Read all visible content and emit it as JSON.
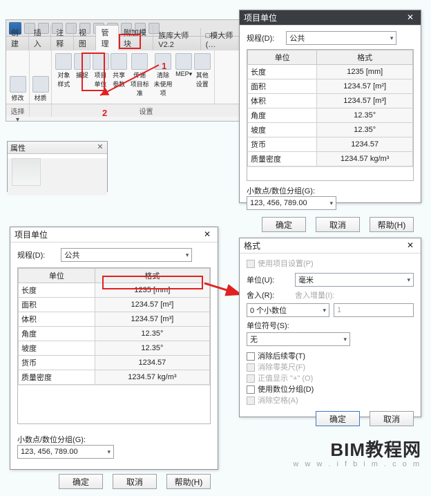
{
  "ribbon": {
    "tabs": [
      "创建",
      "插入",
      "注释",
      "视图",
      "管理",
      "附加模块",
      "族库大师V2.2",
      "□模大师(…"
    ],
    "active_tab": "管理",
    "buttons": {
      "modify": "修改",
      "material": "材质",
      "object_style": "对象\n样式",
      "snap": "捕捉",
      "proj_unit_l1": "项目",
      "proj_unit_l2": "单位",
      "shared_param_l1": "共享",
      "shared_param_l2": "参数",
      "transfer_l1": "传递",
      "transfer_l2": "项目标准",
      "purge_l1": "清除",
      "purge_l2": "未使用项",
      "mep": "MEP▾",
      "addl": "其他\n设置"
    },
    "panels": [
      "选择 ▾",
      "",
      "设置",
      ""
    ],
    "annot": {
      "one": "1",
      "two": "2"
    }
  },
  "properties": {
    "title": "属性",
    "close": "✕"
  },
  "proj_units": {
    "title": "项目单位",
    "discipline_label": "规程(D):",
    "discipline_value": "公共",
    "col_unit": "单位",
    "col_format": "格式",
    "rows": [
      {
        "u": "长度",
        "f": "1235 [mm]"
      },
      {
        "u": "面积",
        "f": "1234.57 [m²]"
      },
      {
        "u": "体积",
        "f": "1234.57 [m³]"
      },
      {
        "u": "角度",
        "f": "12.35°"
      },
      {
        "u": "坡度",
        "f": "12.35°"
      },
      {
        "u": "货币",
        "f": "1234.57"
      },
      {
        "u": "质量密度",
        "f": "1234.57 kg/m³"
      }
    ],
    "grouping_label": "小数点/数位分组(G):",
    "grouping_value1": "123, 456, 789.00",
    "grouping_value2": "123, 456, 789.00",
    "ok": "确定",
    "cancel": "取消",
    "help": "帮助(H)",
    "close": "✕"
  },
  "format": {
    "title": "格式",
    "use_proj": "使用项目设置(P)",
    "unit_label": "单位(U):",
    "unit_value": "毫米",
    "round_label": "舍入(R):",
    "round_value": "0 个小数位",
    "round_inc_label": "舍入增量(I):",
    "round_inc_value": "1",
    "symbol_label": "单位符号(S):",
    "symbol_value": "无",
    "strip_trailing": "消除后续零(T)",
    "strip_feet": "消除零英尺(F)",
    "show_plus": "正值显示 \"+\" (O)",
    "digit_group": "使用数位分组(D)",
    "strip_space": "消除空格(A)",
    "ok": "确定",
    "cancel": "取消",
    "close": "✕"
  },
  "logo": {
    "main": "BIM教程网",
    "sub": "w w w . i f b i m . c o m"
  }
}
